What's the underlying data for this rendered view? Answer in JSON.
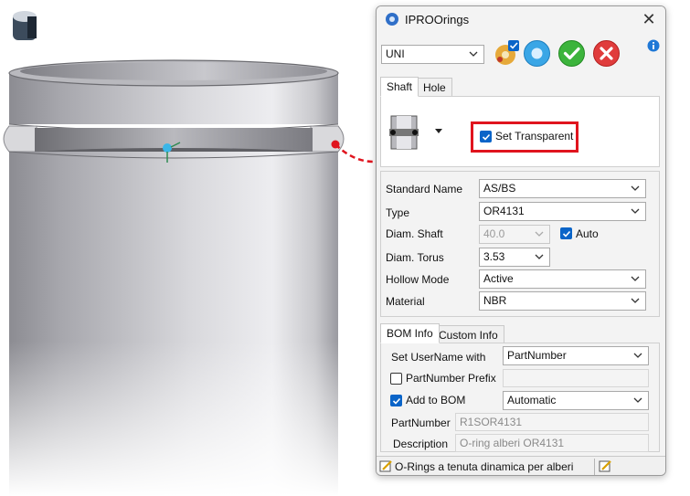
{
  "window": {
    "title": "IPROOrings",
    "close_icon": "close-icon",
    "app_icon": "gear-drop-icon"
  },
  "toolbar": {
    "standard_select": "UNI",
    "info_icon": "info-icon",
    "buttons": [
      "settings-gear-icon",
      "reset-circle-icon",
      "ok-check-icon",
      "cancel-x-icon"
    ]
  },
  "top_tabs": [
    {
      "label": "Shaft",
      "active": true
    },
    {
      "label": "Hole",
      "active": false
    }
  ],
  "shaft_panel": {
    "preview_icon": "shaft-oring-icon",
    "set_transparent": {
      "label": "Set Transparent",
      "checked": true
    }
  },
  "fields": {
    "standard_name": {
      "label": "Standard Name",
      "value": "AS/BS"
    },
    "type": {
      "label": "Type",
      "value": "OR4131"
    },
    "diam_shaft": {
      "label": "Diam. Shaft",
      "value": "40.0",
      "auto_label": "Auto",
      "auto_checked": true
    },
    "diam_torus": {
      "label": "Diam. Torus",
      "value": "3.53"
    },
    "hollow_mode": {
      "label": "Hollow Mode",
      "value": "Active"
    },
    "material": {
      "label": "Material",
      "value": "NBR"
    }
  },
  "bom_tabs": [
    {
      "label": "BOM Info",
      "active": true
    },
    {
      "label": "Custom Info",
      "active": false
    }
  ],
  "bom": {
    "set_username": {
      "label": "Set UserName with",
      "value": "PartNumber"
    },
    "partnumber_prefix": {
      "label": "PartNumber Prefix",
      "checked": false,
      "value": ""
    },
    "add_to_bom": {
      "label": "Add to BOM",
      "checked": true,
      "value": "Automatic"
    },
    "partnumber": {
      "label": "PartNumber",
      "value": "R1SOR4131"
    },
    "description": {
      "label": "Description",
      "value": "O-ring alberi OR4131"
    }
  },
  "status": {
    "text": "O-Rings a tenuta dinamica per alberi",
    "edit_icon": "edit-note-icon"
  },
  "colors": {
    "highlight": "#e0141e",
    "checkbox_blue": "#0a64c8",
    "ok_green": "#3cb43c",
    "cancel_red": "#e03c3c",
    "reset_blue": "#3aa6e6"
  }
}
